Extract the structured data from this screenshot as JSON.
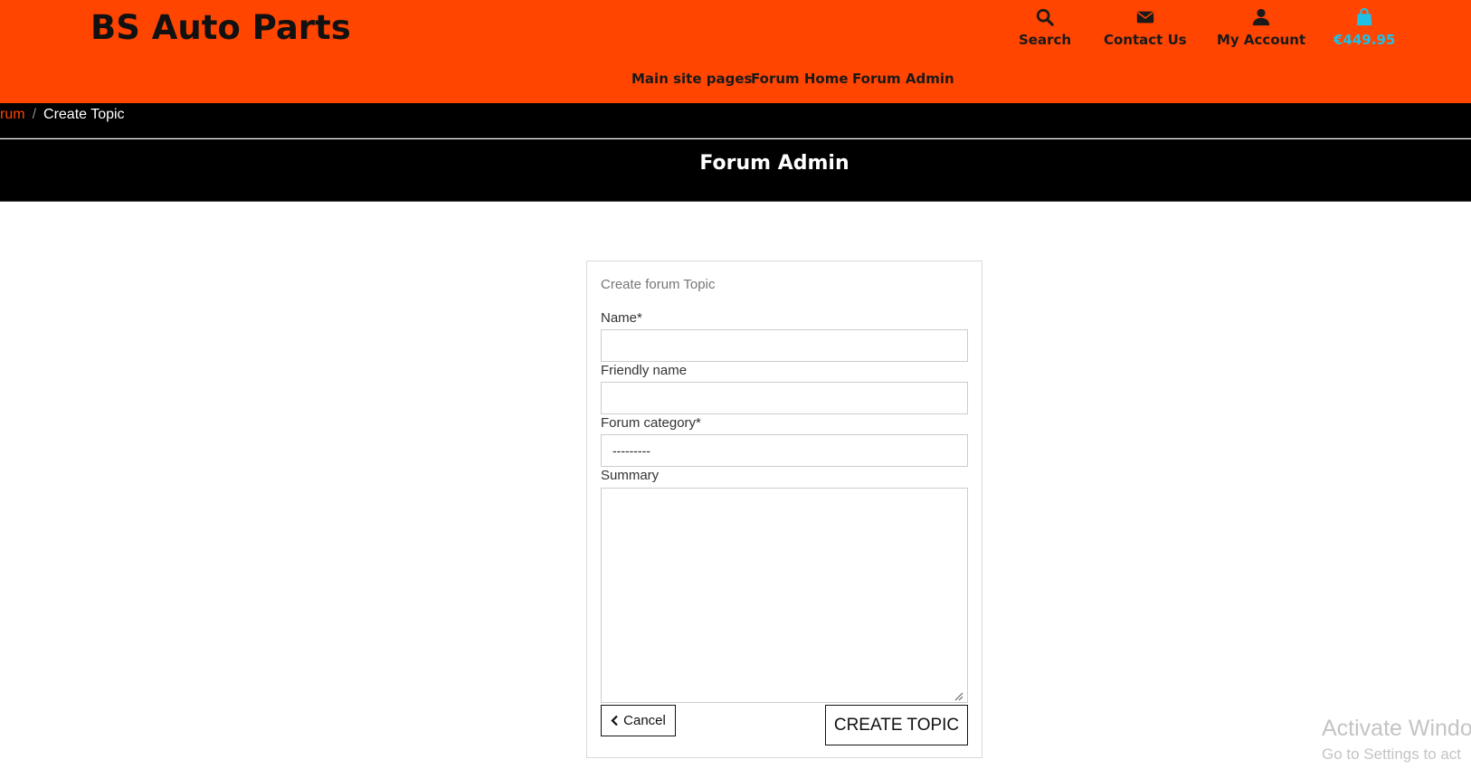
{
  "header": {
    "brand": "BS Auto Parts",
    "links": {
      "search": "Search",
      "contact": "Contact Us",
      "account": "My Account",
      "cart_total": "€449.95"
    },
    "icons": [
      "search-icon",
      "envelope-icon",
      "user-icon",
      "shopping-bag-icon"
    ],
    "nav": [
      "Main site pages",
      "Forum Home",
      "Forum Admin"
    ],
    "colors": {
      "background": "#ff4500",
      "cart_accent": "#1fc0e6"
    }
  },
  "breadcrumb": {
    "parent": "rum",
    "separator": "/",
    "current": "Create Topic"
  },
  "page": {
    "title": "Forum Admin"
  },
  "form": {
    "title": "Create forum Topic",
    "name_label": "Name*",
    "name_value": "",
    "friendly_label": "Friendly name",
    "friendly_value": "",
    "category_label": "Forum category*",
    "category_selected": "---------",
    "summary_label": "Summary",
    "summary_value": "",
    "cancel_label": "Cancel",
    "submit_label": "CREATE TOPIC"
  },
  "watermark": {
    "line1": "Activate Windo",
    "line2": "Go to Settings to act"
  }
}
